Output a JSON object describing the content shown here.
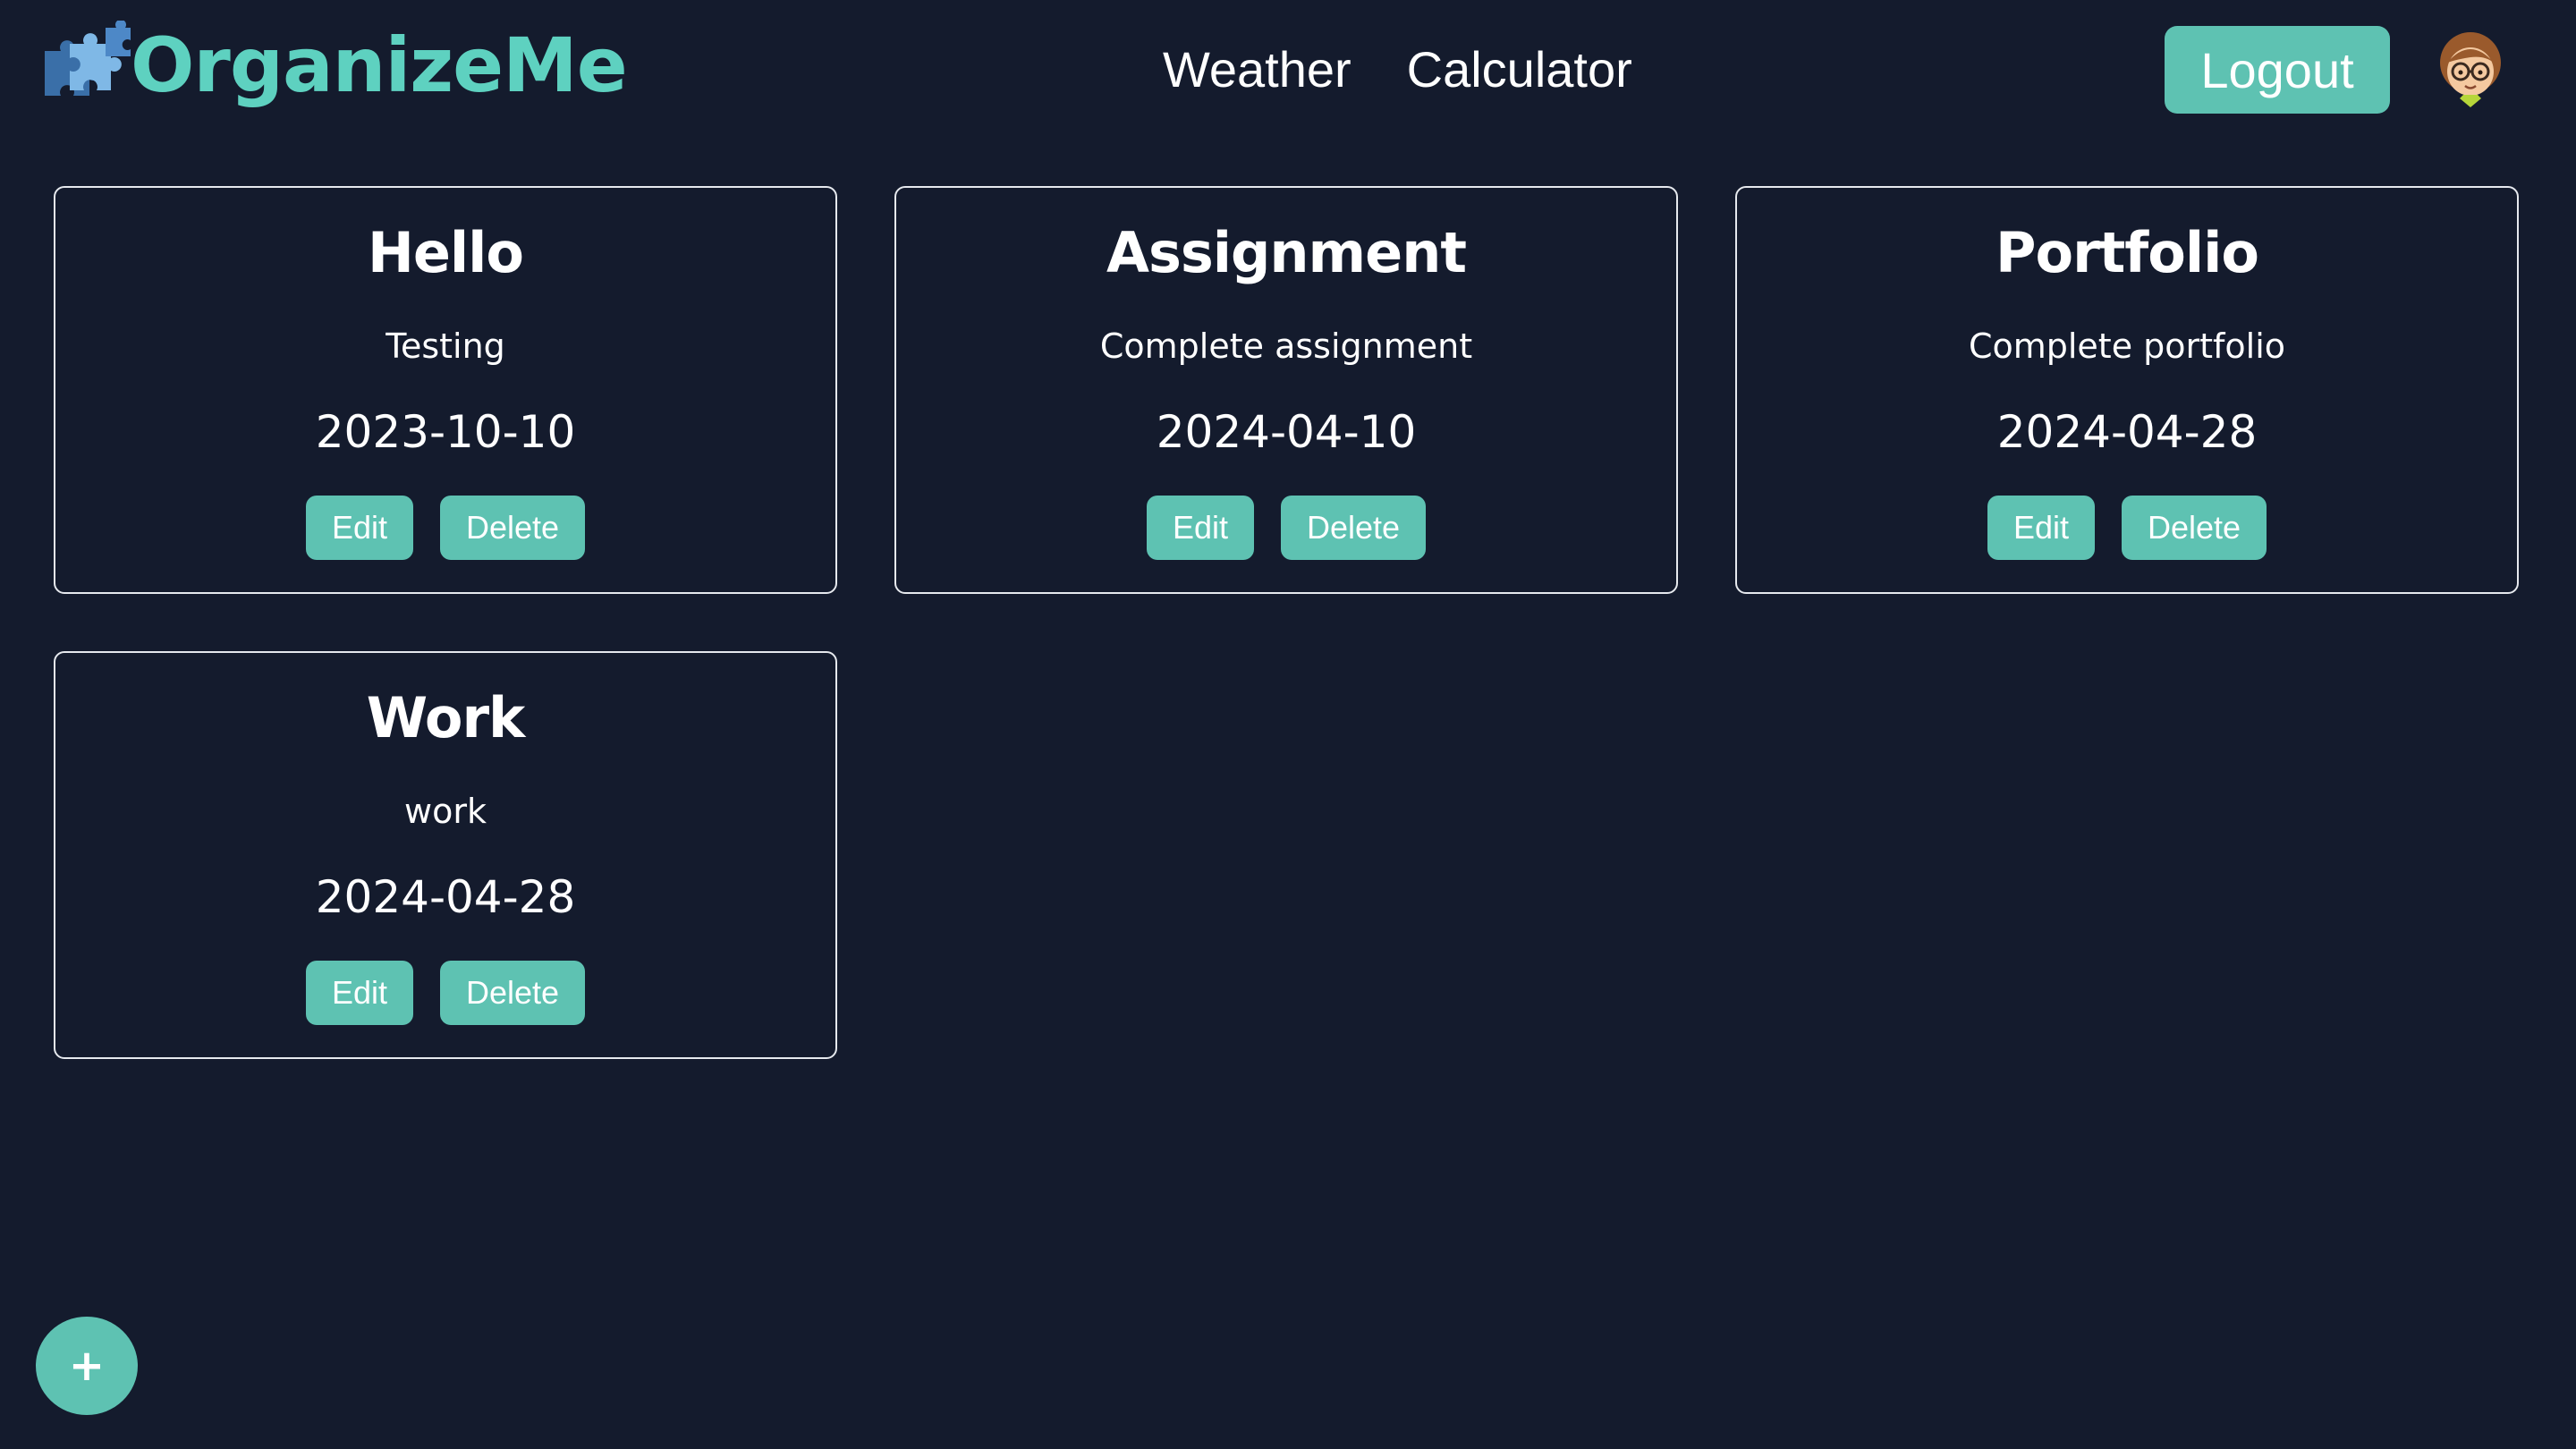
{
  "header": {
    "brand_name": "OrganizeMe",
    "logo_icon": "puzzle-pieces-icon",
    "nav": {
      "weather": "Weather",
      "calculator": "Calculator"
    },
    "logout_label": "Logout",
    "avatar_icon": "user-avatar-icon"
  },
  "cards": [
    {
      "title": "Hello",
      "description": "Testing",
      "date": "2023-10-10",
      "edit_label": "Edit",
      "delete_label": "Delete"
    },
    {
      "title": "Assignment",
      "description": "Complete assignment",
      "date": "2024-04-10",
      "edit_label": "Edit",
      "delete_label": "Delete"
    },
    {
      "title": "Portfolio",
      "description": "Complete portfolio",
      "date": "2024-04-28",
      "edit_label": "Edit",
      "delete_label": "Delete"
    },
    {
      "title": "Work",
      "description": "work",
      "date": "2024-04-28",
      "edit_label": "Edit",
      "delete_label": "Delete"
    }
  ],
  "fab": {
    "label": "+",
    "icon": "plus-icon"
  },
  "colors": {
    "background": "#141b2d",
    "accent": "#5ec2b2",
    "brand_text": "#5ed1c0"
  }
}
